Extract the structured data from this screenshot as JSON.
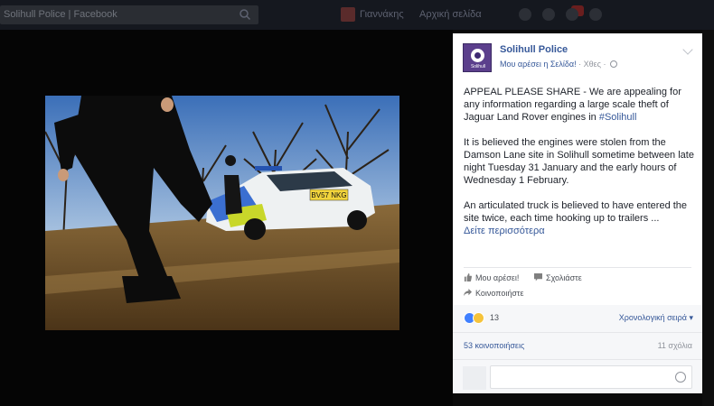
{
  "topbar": {
    "search_placeholder": "Solihull Police | Facebook",
    "user_name": "Γιαννάκης",
    "home_label": "Αρχική σελίδα"
  },
  "post": {
    "page_name": "Solihull Police",
    "avatar_caption": "Solihull",
    "like_page": "Μου αρέσει η Σελίδα!",
    "timestamp": "Χθες",
    "paragraph1": "APPEAL PLEASE SHARE - We are appealing for any information regarding a large scale theft of Jaguar Land Rover engines in ",
    "hashtag": "#Solihull",
    "paragraph2": "It is believed the engines were stolen from the Damson Lane site in Solihull sometime between late night Tuesday 31 January and the early hours of Wednesday 1 February.",
    "paragraph3": "An articulated truck is believed to have entered the site twice, each time hooking up to trailers ...",
    "see_more": "Δείτε περισσότερα"
  },
  "actions": {
    "like": "Μου αρέσει!",
    "comment": "Σχολιάστε",
    "share": "Κοινοποιήστε"
  },
  "stats": {
    "reaction_count": "13",
    "order_label": "Χρονολογική σειρά",
    "shares_label": "53 κοινοποιήσεις",
    "comments_label": "11 σχόλια"
  },
  "photo": {
    "plate": "BV57 NKG"
  },
  "colors": {
    "link": "#365899",
    "like_reaction": "#4080ff",
    "wow_reaction": "#f5c33b"
  }
}
